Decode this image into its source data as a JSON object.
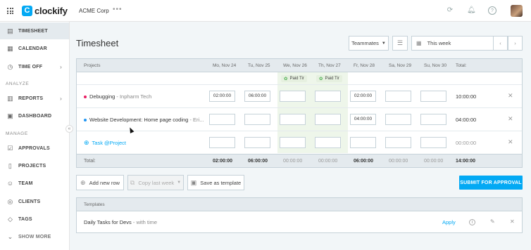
{
  "topbar": {
    "brand": "clockify",
    "workspace": "ACME Corp",
    "more": "•••",
    "icons": [
      "apps-grid-icon",
      "timer-icon",
      "bell-icon",
      "help-icon"
    ]
  },
  "sidebar": {
    "items": [
      {
        "label": "TIMESHEET",
        "icon": "timesheet-icon",
        "active": true
      },
      {
        "label": "CALENDAR",
        "icon": "calendar-icon"
      },
      {
        "label": "TIME OFF",
        "icon": "clock-icon",
        "chevron": true
      },
      {
        "label": "REPORTS",
        "icon": "chart-icon",
        "chevron": true
      },
      {
        "label": "DASHBOARD",
        "icon": "dashboard-icon"
      },
      {
        "label": "APPROVALS",
        "icon": "approvals-icon"
      },
      {
        "label": "PROJECTS",
        "icon": "document-icon"
      },
      {
        "label": "TEAM",
        "icon": "team-icon"
      },
      {
        "label": "CLIENTS",
        "icon": "clients-icon"
      },
      {
        "label": "TAGS",
        "icon": "tag-icon"
      },
      {
        "label": "SHOW MORE",
        "icon": "chevron-down-icon"
      }
    ],
    "headings": {
      "analyze": "ANALYZE",
      "manage": "MANAGE"
    },
    "collapse": "«"
  },
  "page": {
    "title": "Timesheet",
    "teammates": "Teammates",
    "week": "This week",
    "prev": "‹",
    "next": "›"
  },
  "table": {
    "columns": {
      "projects": "Projects",
      "days": [
        "Mo, Nov 24",
        "Tu, Nov 25",
        "We, Nov 26",
        "Th, Nov 27",
        "Fr, Nov 28",
        "Sa, Nov 29",
        "Su, Nov 30"
      ],
      "total": "Total:"
    },
    "time_off": {
      "label": "Paid Tir",
      "icon": "leaf-icon"
    },
    "rows": [
      {
        "project": "Debugging",
        "client": "Inpharm Tech",
        "color": "#e91e63",
        "cells": [
          "02:00:00",
          "06:00:00",
          "",
          "",
          "02:00:00",
          "",
          ""
        ],
        "total": "10:00:00"
      },
      {
        "project": "Website Development: Home page coding",
        "client": "Eri...",
        "color": "#2196f3",
        "cells": [
          "",
          "",
          "",
          "",
          "04:00:00",
          "",
          ""
        ],
        "total": "04:00:00"
      },
      {
        "project": "Task @Project",
        "client": "",
        "color": "#03a9f4",
        "cells": [
          "",
          "",
          "",
          "",
          "",
          "",
          ""
        ],
        "total": "00:00:00"
      }
    ],
    "footer": {
      "label": "Total:",
      "values": [
        "02:00:00",
        "06:00:00",
        "00:00:00",
        "00:00:00",
        "06:00:00",
        "00:00:00",
        "00:00:00"
      ],
      "total": "14:00:00"
    }
  },
  "actions": {
    "add_row": "Add new row",
    "copy_week": "Copy last week",
    "save_template": "Save as template",
    "submit": "SUBMIT FOR APPROVAL"
  },
  "templates": {
    "heading": "Templates",
    "items": [
      {
        "name": "Daily Tasks for Devs",
        "sub": "- with time",
        "apply": "Apply"
      }
    ]
  },
  "colors": {
    "accent": "#03a9f4",
    "sidebar_active": "#e4eaee",
    "time_off_band": "#eef6ea"
  }
}
